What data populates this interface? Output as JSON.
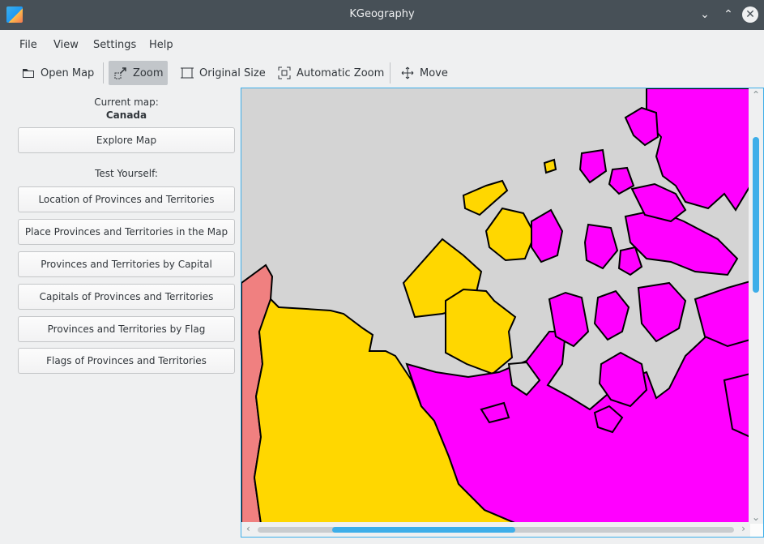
{
  "window": {
    "title": "KGeography"
  },
  "menu": {
    "file": "File",
    "view": "View",
    "settings": "Settings",
    "help": "Help"
  },
  "toolbar": {
    "open_map": "Open Map",
    "zoom": "Zoom",
    "original_size": "Original Size",
    "automatic_zoom": "Automatic Zoom",
    "move": "Move"
  },
  "panel": {
    "current_map_label": "Current map:",
    "current_map_name": "Canada",
    "explore_button": "Explore Map",
    "test_label": "Test Yourself:",
    "tests": [
      "Location of Provinces and Territories",
      "Place Provinces and Territories in the Map",
      "Provinces and Territories by Capital",
      "Capitals of Provinces and Territories",
      "Provinces and Territories by Flag",
      "Flags of Provinces and Territories"
    ]
  },
  "map": {
    "colors": {
      "sea": "#d4d4d4",
      "yukon": "#f08080",
      "northwest_territories": "#ffd700",
      "nunavut": "#ff00ff",
      "border": "#000000"
    }
  }
}
